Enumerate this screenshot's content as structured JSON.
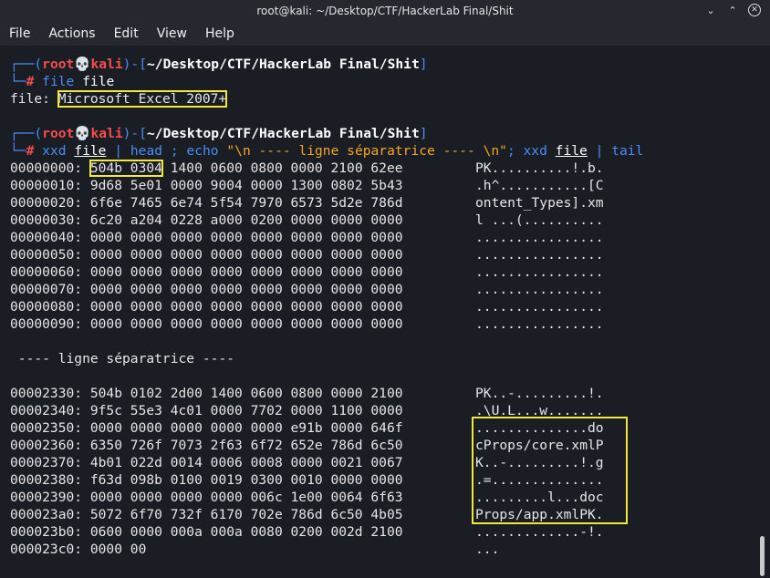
{
  "window": {
    "title": "root@kali: ~/Desktop/CTF/HackerLab Final/Shit",
    "minimize_glyph": "⌄",
    "maximize_glyph": "⌃",
    "close_glyph": "✕"
  },
  "menu": [
    "File",
    "Actions",
    "Edit",
    "View",
    "Help"
  ],
  "prompt": {
    "corner_top": "┌──",
    "open_paren": "(",
    "user": "root",
    "skull": "💀",
    "host": "kali",
    "mid": ")-[",
    "path": "~/Desktop/CTF/HackerLab Final/Shit",
    "close": "]",
    "corner_bottom": "└─",
    "hash": "#"
  },
  "cmd1": {
    "cmd": "file",
    "arg": "file"
  },
  "file_output": {
    "prefix": "file: ",
    "value": "Microsoft Excel 2007+"
  },
  "cmd2": {
    "p1": "xxd",
    "p2": "file",
    "p3": "|",
    "p4": "head",
    "p5": ";",
    "p6": "echo",
    "p7": "\"\\n ---- ligne séparatrice ---- \\n\"",
    "p8": ";",
    "p9": "xxd",
    "p10": "file",
    "p11": "|",
    "p12": "tail"
  },
  "head_first": {
    "addr": "00000000: ",
    "magic": "504b 0304",
    "rest": " 1400 0600 0800 0000 2100 62ee"
  },
  "head_lines": [
    {
      "hex": "00000000: 504b 0304 1400 0600 0800 0000 2100 62ee",
      "ascii": "PK..........!.b."
    },
    {
      "hex": "00000010: 9d68 5e01 0000 9004 0000 1300 0802 5b43",
      "ascii": ".h^...........[C"
    },
    {
      "hex": "00000020: 6f6e 7465 6e74 5f54 7970 6573 5d2e 786d",
      "ascii": "ontent_Types].xm"
    },
    {
      "hex": "00000030: 6c20 a204 0228 a000 0200 0000 0000 0000",
      "ascii": "l ...(.........."
    },
    {
      "hex": "00000040: 0000 0000 0000 0000 0000 0000 0000 0000",
      "ascii": "................"
    },
    {
      "hex": "00000050: 0000 0000 0000 0000 0000 0000 0000 0000",
      "ascii": "................"
    },
    {
      "hex": "00000060: 0000 0000 0000 0000 0000 0000 0000 0000",
      "ascii": "................"
    },
    {
      "hex": "00000070: 0000 0000 0000 0000 0000 0000 0000 0000",
      "ascii": "................"
    },
    {
      "hex": "00000080: 0000 0000 0000 0000 0000 0000 0000 0000",
      "ascii": "................"
    },
    {
      "hex": "00000090: 0000 0000 0000 0000 0000 0000 0000 0000",
      "ascii": "................"
    }
  ],
  "separator": " ---- ligne séparatrice ----",
  "tail_lines": [
    {
      "hex": "00002330: 504b 0102 2d00 1400 0600 0800 0000 2100",
      "ascii": "PK..-.........!."
    },
    {
      "hex": "00002340: 9f5c 55e3 4c01 0000 7702 0000 1100 0000",
      "ascii": ".\\U.L...w......."
    },
    {
      "hex": "00002350: 0000 0000 0000 0000 0000 e91b 0000 646f",
      "ascii": "..............do"
    },
    {
      "hex": "00002360: 6350 726f 7073 2f63 6f72 652e 786d 6c50",
      "ascii": "cProps/core.xmlP"
    },
    {
      "hex": "00002370: 4b01 022d 0014 0006 0008 0000 0021 0067",
      "ascii": "K..-.........!.g"
    },
    {
      "hex": "00002380: f63d 098b 0100 0019 0300 0010 0000 0000",
      "ascii": ".=.............."
    },
    {
      "hex": "00002390: 0000 0000 0000 0000 006c 1e00 0064 6f63",
      "ascii": ".........l...doc"
    },
    {
      "hex": "000023a0: 5072 6f70 732f 6170 702e 786d 6c50 4b05",
      "ascii": "Props/app.xmlPK."
    },
    {
      "hex": "000023b0: 0600 0000 000a 000a 0080 0200 002d 2100",
      "ascii": ".............-!."
    },
    {
      "hex": "000023c0: 0000 00",
      "ascii": "..."
    }
  ],
  "colors": {
    "prompt_frame": "#4a8cf5",
    "user_host": "#f34d4d",
    "string": "#f5a623",
    "highlight": "#f2e93a",
    "background": "#1b1d25"
  }
}
